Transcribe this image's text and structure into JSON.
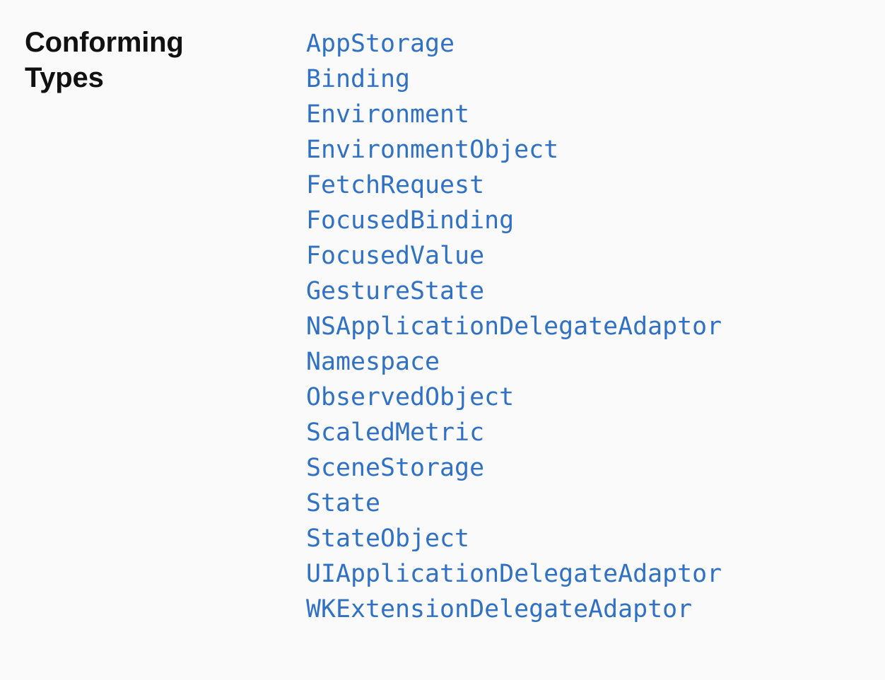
{
  "section": {
    "title": "Conforming Types",
    "link_color": "#3171c4",
    "types": [
      "AppStorage",
      "Binding",
      "Environment",
      "EnvironmentObject",
      "FetchRequest",
      "FocusedBinding",
      "FocusedValue",
      "GestureState",
      "NSApplicationDelegateAdaptor",
      "Namespace",
      "ObservedObject",
      "ScaledMetric",
      "SceneStorage",
      "State",
      "StateObject",
      "UIApplicationDelegateAdaptor",
      "WKExtensionDelegateAdaptor"
    ]
  }
}
